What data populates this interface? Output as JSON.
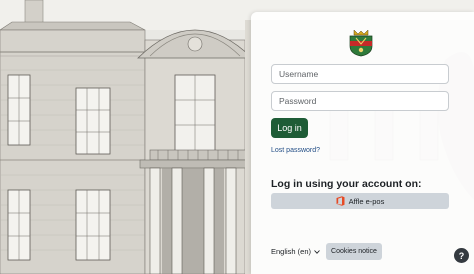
{
  "login": {
    "username_placeholder": "Username",
    "password_placeholder": "Password",
    "login_label": "Log in",
    "lost_password_label": "Lost password?"
  },
  "sso": {
    "heading": "Log in using your account on:",
    "provider_label": "Affle e-pos",
    "provider_icon": "office-icon"
  },
  "footer": {
    "language_label": "English (en)",
    "cookies_label": "Cookies notice",
    "help_label": "?"
  },
  "colors": {
    "primary": "#1e5c36",
    "link": "#234e86",
    "secondary_button": "#ced4da",
    "help_button": "#343a40"
  }
}
